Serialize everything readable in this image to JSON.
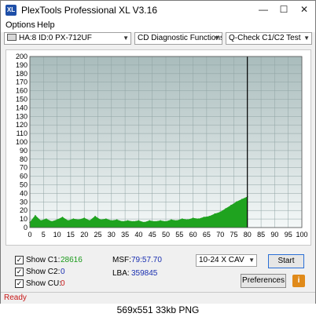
{
  "window": {
    "title": "PlexTools Professional XL V3.16",
    "app_icon_text": "XL",
    "minimize": "—",
    "maximize": "☐",
    "close": "✕"
  },
  "menu": {
    "options": "Options",
    "help": "Help"
  },
  "toolbar": {
    "drive": "HA:8 ID:0  PX-712UF",
    "function": "CD Diagnostic Functions",
    "test": "Q-Check C1/C2 Test"
  },
  "chart_data": {
    "type": "area",
    "title": "",
    "xlabel": "",
    "ylabel": "",
    "xlim": [
      0,
      100
    ],
    "ylim": [
      0,
      200
    ],
    "x_ticks": [
      0,
      5,
      10,
      15,
      20,
      25,
      30,
      35,
      40,
      45,
      50,
      55,
      60,
      65,
      70,
      75,
      80,
      85,
      90,
      95,
      100
    ],
    "y_ticks": [
      0,
      10,
      20,
      30,
      40,
      50,
      60,
      70,
      80,
      90,
      100,
      110,
      120,
      130,
      140,
      150,
      160,
      170,
      180,
      190,
      200
    ],
    "grid": true,
    "disc_end_marker": 79.96,
    "series": [
      {
        "color": "#1fa31f",
        "x": [
          0,
          2,
          4,
          6,
          8,
          10,
          12,
          14,
          16,
          18,
          20,
          22,
          24,
          26,
          28,
          30,
          32,
          34,
          36,
          38,
          40,
          42,
          44,
          46,
          48,
          50,
          52,
          54,
          56,
          58,
          60,
          62,
          64,
          66,
          68,
          70,
          72,
          74,
          76,
          78,
          80
        ],
        "values": [
          6,
          14,
          8,
          10,
          7,
          9,
          12,
          8,
          10,
          9,
          11,
          8,
          13,
          9,
          10,
          8,
          9,
          7,
          8,
          7,
          8,
          6,
          8,
          7,
          8,
          7,
          9,
          8,
          10,
          9,
          11,
          10,
          12,
          13,
          16,
          18,
          22,
          26,
          30,
          33,
          36
        ]
      }
    ]
  },
  "stats": {
    "show_c1_label": "Show C1:",
    "c1_value": "28616",
    "show_c2_label": "Show C2:",
    "c2_value": "0",
    "show_cu_label": "Show CU:",
    "cu_value": "0",
    "msf_label": "MSF:",
    "msf_value": "79:57.70",
    "lba_label": "LBA:",
    "lba_value": "359845"
  },
  "controls": {
    "speed": "10-24 X CAV",
    "start": "Start",
    "preferences": "Preferences",
    "info": "i"
  },
  "status": {
    "text": "Ready"
  },
  "caption": {
    "text": "569x551 33kb PNG"
  }
}
